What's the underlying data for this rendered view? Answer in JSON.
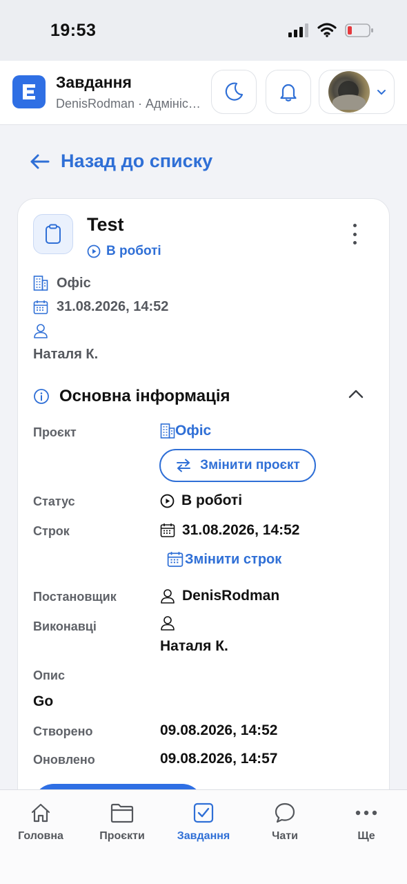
{
  "status_bar": {
    "time": "19:53"
  },
  "header": {
    "title": "Завдання",
    "subtitle": "DenisRodman · Адміністратор"
  },
  "back_link": {
    "label": "Назад до списку"
  },
  "task": {
    "title": "Test",
    "status": "В роботі",
    "project": "Офіс",
    "deadline": "31.08.2026, 14:52",
    "assignee": "Наталя К."
  },
  "section": {
    "title": "Основна інформація",
    "labels": {
      "project": "Проєкт",
      "status": "Статус",
      "deadline": "Строк",
      "reporter": "Постановщик",
      "assignees": "Виконавці",
      "description": "Опис",
      "created": "Створено",
      "updated": "Оновлено"
    },
    "values": {
      "project": "Офіс",
      "status": "В роботі",
      "deadline": "31.08.2026, 14:52",
      "reporter": "DenisRodman",
      "assignees": "Наталя К.",
      "description": "Go",
      "created": "09.08.2026, 14:52",
      "updated": "09.08.2026, 14:57"
    },
    "change_project_label": "Змінити проєкт",
    "change_deadline_label": "Змінити строк"
  },
  "bottom_nav": [
    {
      "label": "Головна",
      "icon": "home-icon"
    },
    {
      "label": "Проєкти",
      "icon": "folder-icon"
    },
    {
      "label": "Завдання",
      "icon": "task-check-icon",
      "active": true
    },
    {
      "label": "Чати",
      "icon": "chat-icon"
    },
    {
      "label": "Ще",
      "icon": "more-dots-icon"
    }
  ],
  "colors": {
    "accent": "#2f6fd6",
    "brand": "#2f6fe4",
    "background": "#f2f3f7",
    "battery_low": "#e5393d"
  }
}
